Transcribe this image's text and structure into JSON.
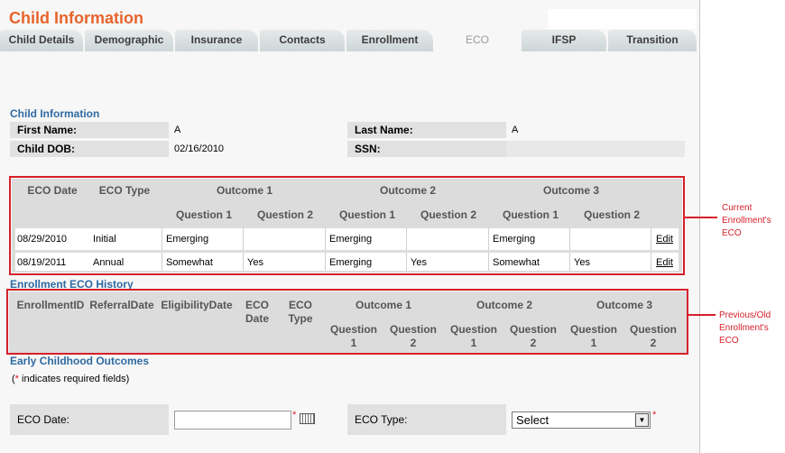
{
  "page": {
    "title": "Child Information"
  },
  "tabs": [
    "Child Details",
    "Demographic",
    "Insurance",
    "Contacts",
    "Enrollment",
    "ECO",
    "IFSP",
    "Transition"
  ],
  "child_info": {
    "section_title": "Child Information",
    "first_name_label": "First Name:",
    "first_name_value": "A",
    "last_name_label": "Last Name:",
    "last_name_value": "A",
    "dob_label": "Child DOB:",
    "dob_value": "02/16/2010",
    "ssn_label": "SSN:",
    "ssn_value": ""
  },
  "current_eco": {
    "headers": {
      "eco_date": "ECO Date",
      "eco_type": "ECO Type",
      "outcome1": "Outcome 1",
      "outcome2": "Outcome 2",
      "outcome3": "Outcome 3",
      "question1": "Question 1",
      "question2": "Question 2"
    },
    "rows": [
      {
        "date": "08/29/2010",
        "type": "Initial",
        "o1q1": "Emerging",
        "o1q2": "",
        "o2q1": "Emerging",
        "o2q2": "",
        "o3q1": "Emerging",
        "o3q2": "",
        "action": "Edit"
      },
      {
        "date": "08/19/2011",
        "type": "Annual",
        "o1q1": "Somewhat",
        "o1q2": "Yes",
        "o2q1": "Emerging",
        "o2q2": "Yes",
        "o3q1": "Somewhat",
        "o3q2": "Yes",
        "action": "Edit"
      }
    ],
    "annotation": [
      "Current",
      "Enrollment's",
      "ECO"
    ]
  },
  "history": {
    "section_title": "Enrollment ECO History",
    "headers": {
      "enrollment_id": "EnrollmentID",
      "referral_date": "ReferralDate",
      "eligibility_date": "EligibilityDate",
      "eco_date_1": "ECO",
      "eco_date_2": "Date",
      "eco_type_1": "ECO",
      "eco_type_2": "Type",
      "outcome1": "Outcome 1",
      "outcome2": "Outcome 2",
      "outcome3": "Outcome 3",
      "question": "Question",
      "q1": "1",
      "q2": "2"
    },
    "annotation": [
      "Previous/Old",
      "Enrollment's",
      "ECO"
    ]
  },
  "eco_form": {
    "section_title": "Early Childhood Outcomes",
    "required_note_star": "*",
    "required_note_text": " indicates required fields)",
    "required_note_open": "(",
    "eco_date_label": "ECO Date:",
    "eco_date_value": "",
    "eco_type_label": "ECO Type:",
    "eco_type_selected": "Select",
    "star": "*"
  }
}
